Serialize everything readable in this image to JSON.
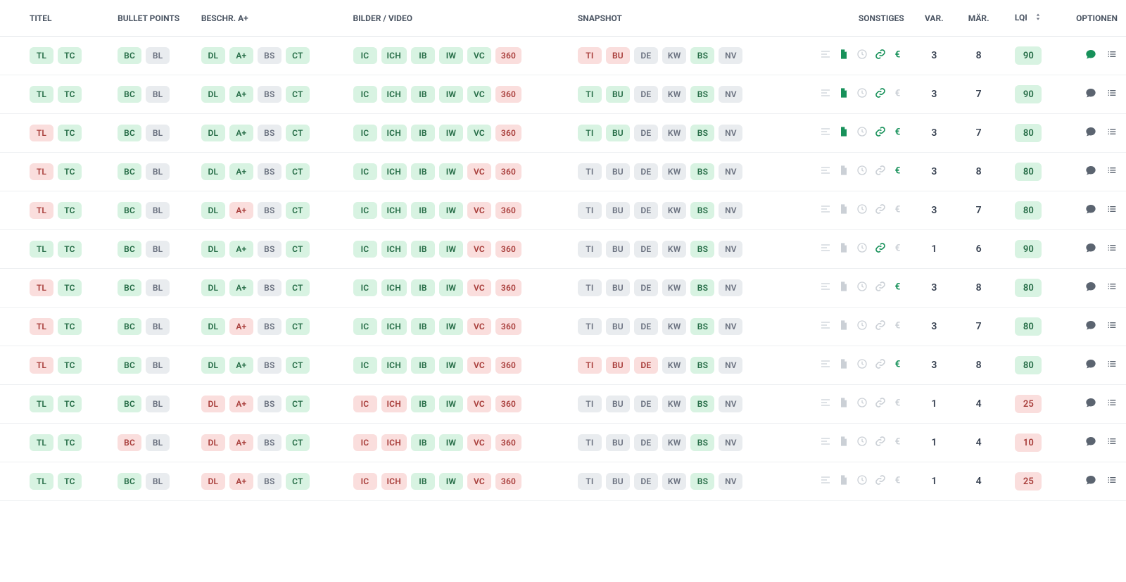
{
  "columns": {
    "titel": "TITEL",
    "bullet": "BULLET POINTS",
    "beschr": "BESCHR. A+",
    "bilder": "BILDER / VIDEO",
    "snapshot": "SNAPSHOT",
    "sonstiges": "SONSTIGES",
    "var": "VAR.",
    "maer": "MÄR.",
    "lqi": "LQI",
    "optionen": "OPTIONEN"
  },
  "rows": [
    {
      "titel": [
        {
          "t": "TL",
          "s": "ok"
        },
        {
          "t": "TC",
          "s": "ok"
        }
      ],
      "bullet": [
        {
          "t": "BC",
          "s": "ok"
        },
        {
          "t": "BL",
          "s": "mut"
        }
      ],
      "beschr": [
        {
          "t": "DL",
          "s": "ok"
        },
        {
          "t": "A+",
          "s": "ok"
        },
        {
          "t": "BS",
          "s": "mut"
        },
        {
          "t": "CT",
          "s": "ok"
        }
      ],
      "bilder": [
        {
          "t": "IC",
          "s": "ok"
        },
        {
          "t": "ICH",
          "s": "ok"
        },
        {
          "t": "IB",
          "s": "ok"
        },
        {
          "t": "IW",
          "s": "ok"
        },
        {
          "t": "VC",
          "s": "ok"
        },
        {
          "t": "360",
          "s": "bad"
        }
      ],
      "snapshot": [
        {
          "t": "TI",
          "s": "bad"
        },
        {
          "t": "BU",
          "s": "bad"
        },
        {
          "t": "DE",
          "s": "mut"
        },
        {
          "t": "KW",
          "s": "mut"
        },
        {
          "t": "BS",
          "s": "ok"
        },
        {
          "t": "NV",
          "s": "mut"
        }
      ],
      "sonst": {
        "align": true,
        "doc": true,
        "clock": false,
        "link": true,
        "euro": true
      },
      "var": 3,
      "maer": 8,
      "lqi": 90,
      "lqi_s": "ok",
      "chat_active": true
    },
    {
      "titel": [
        {
          "t": "TL",
          "s": "ok"
        },
        {
          "t": "TC",
          "s": "ok"
        }
      ],
      "bullet": [
        {
          "t": "BC",
          "s": "ok"
        },
        {
          "t": "BL",
          "s": "mut"
        }
      ],
      "beschr": [
        {
          "t": "DL",
          "s": "ok"
        },
        {
          "t": "A+",
          "s": "ok"
        },
        {
          "t": "BS",
          "s": "mut"
        },
        {
          "t": "CT",
          "s": "ok"
        }
      ],
      "bilder": [
        {
          "t": "IC",
          "s": "ok"
        },
        {
          "t": "ICH",
          "s": "ok"
        },
        {
          "t": "IB",
          "s": "ok"
        },
        {
          "t": "IW",
          "s": "ok"
        },
        {
          "t": "VC",
          "s": "ok"
        },
        {
          "t": "360",
          "s": "bad"
        }
      ],
      "snapshot": [
        {
          "t": "TI",
          "s": "ok"
        },
        {
          "t": "BU",
          "s": "ok"
        },
        {
          "t": "DE",
          "s": "mut"
        },
        {
          "t": "KW",
          "s": "mut"
        },
        {
          "t": "BS",
          "s": "ok"
        },
        {
          "t": "NV",
          "s": "mut"
        }
      ],
      "sonst": {
        "align": true,
        "doc": true,
        "clock": false,
        "link": true,
        "euro": false
      },
      "var": 3,
      "maer": 7,
      "lqi": 90,
      "lqi_s": "ok",
      "chat_active": false
    },
    {
      "titel": [
        {
          "t": "TL",
          "s": "bad"
        },
        {
          "t": "TC",
          "s": "ok"
        }
      ],
      "bullet": [
        {
          "t": "BC",
          "s": "ok"
        },
        {
          "t": "BL",
          "s": "mut"
        }
      ],
      "beschr": [
        {
          "t": "DL",
          "s": "ok"
        },
        {
          "t": "A+",
          "s": "ok"
        },
        {
          "t": "BS",
          "s": "mut"
        },
        {
          "t": "CT",
          "s": "ok"
        }
      ],
      "bilder": [
        {
          "t": "IC",
          "s": "ok"
        },
        {
          "t": "ICH",
          "s": "ok"
        },
        {
          "t": "IB",
          "s": "ok"
        },
        {
          "t": "IW",
          "s": "ok"
        },
        {
          "t": "VC",
          "s": "ok"
        },
        {
          "t": "360",
          "s": "bad"
        }
      ],
      "snapshot": [
        {
          "t": "TI",
          "s": "ok"
        },
        {
          "t": "BU",
          "s": "ok"
        },
        {
          "t": "DE",
          "s": "mut"
        },
        {
          "t": "KW",
          "s": "mut"
        },
        {
          "t": "BS",
          "s": "ok"
        },
        {
          "t": "NV",
          "s": "mut"
        }
      ],
      "sonst": {
        "align": true,
        "doc": true,
        "clock": false,
        "link": true,
        "euro": true
      },
      "var": 3,
      "maer": 7,
      "lqi": 80,
      "lqi_s": "ok",
      "chat_active": false
    },
    {
      "titel": [
        {
          "t": "TL",
          "s": "bad"
        },
        {
          "t": "TC",
          "s": "ok"
        }
      ],
      "bullet": [
        {
          "t": "BC",
          "s": "ok"
        },
        {
          "t": "BL",
          "s": "mut"
        }
      ],
      "beschr": [
        {
          "t": "DL",
          "s": "ok"
        },
        {
          "t": "A+",
          "s": "ok"
        },
        {
          "t": "BS",
          "s": "mut"
        },
        {
          "t": "CT",
          "s": "ok"
        }
      ],
      "bilder": [
        {
          "t": "IC",
          "s": "ok"
        },
        {
          "t": "ICH",
          "s": "ok"
        },
        {
          "t": "IB",
          "s": "ok"
        },
        {
          "t": "IW",
          "s": "ok"
        },
        {
          "t": "VC",
          "s": "bad"
        },
        {
          "t": "360",
          "s": "bad"
        }
      ],
      "snapshot": [
        {
          "t": "TI",
          "s": "mut"
        },
        {
          "t": "BU",
          "s": "mut"
        },
        {
          "t": "DE",
          "s": "mut"
        },
        {
          "t": "KW",
          "s": "mut"
        },
        {
          "t": "BS",
          "s": "ok"
        },
        {
          "t": "NV",
          "s": "mut"
        }
      ],
      "sonst": {
        "align": true,
        "doc": false,
        "clock": false,
        "link": false,
        "euro": true
      },
      "var": 3,
      "maer": 8,
      "lqi": 80,
      "lqi_s": "ok",
      "chat_active": false
    },
    {
      "titel": [
        {
          "t": "TL",
          "s": "bad"
        },
        {
          "t": "TC",
          "s": "ok"
        }
      ],
      "bullet": [
        {
          "t": "BC",
          "s": "ok"
        },
        {
          "t": "BL",
          "s": "mut"
        }
      ],
      "beschr": [
        {
          "t": "DL",
          "s": "ok"
        },
        {
          "t": "A+",
          "s": "bad"
        },
        {
          "t": "BS",
          "s": "mut"
        },
        {
          "t": "CT",
          "s": "ok"
        }
      ],
      "bilder": [
        {
          "t": "IC",
          "s": "ok"
        },
        {
          "t": "ICH",
          "s": "ok"
        },
        {
          "t": "IB",
          "s": "ok"
        },
        {
          "t": "IW",
          "s": "ok"
        },
        {
          "t": "VC",
          "s": "bad"
        },
        {
          "t": "360",
          "s": "bad"
        }
      ],
      "snapshot": [
        {
          "t": "TI",
          "s": "mut"
        },
        {
          "t": "BU",
          "s": "mut"
        },
        {
          "t": "DE",
          "s": "mut"
        },
        {
          "t": "KW",
          "s": "mut"
        },
        {
          "t": "BS",
          "s": "ok"
        },
        {
          "t": "NV",
          "s": "mut"
        }
      ],
      "sonst": {
        "align": true,
        "doc": false,
        "clock": false,
        "link": false,
        "euro": false
      },
      "var": 3,
      "maer": 7,
      "lqi": 80,
      "lqi_s": "ok",
      "chat_active": false
    },
    {
      "titel": [
        {
          "t": "TL",
          "s": "ok"
        },
        {
          "t": "TC",
          "s": "ok"
        }
      ],
      "bullet": [
        {
          "t": "BC",
          "s": "ok"
        },
        {
          "t": "BL",
          "s": "mut"
        }
      ],
      "beschr": [
        {
          "t": "DL",
          "s": "ok"
        },
        {
          "t": "A+",
          "s": "ok"
        },
        {
          "t": "BS",
          "s": "mut"
        },
        {
          "t": "CT",
          "s": "ok"
        }
      ],
      "bilder": [
        {
          "t": "IC",
          "s": "ok"
        },
        {
          "t": "ICH",
          "s": "ok"
        },
        {
          "t": "IB",
          "s": "ok"
        },
        {
          "t": "IW",
          "s": "ok"
        },
        {
          "t": "VC",
          "s": "bad"
        },
        {
          "t": "360",
          "s": "bad"
        }
      ],
      "snapshot": [
        {
          "t": "TI",
          "s": "mut"
        },
        {
          "t": "BU",
          "s": "mut"
        },
        {
          "t": "DE",
          "s": "mut"
        },
        {
          "t": "KW",
          "s": "mut"
        },
        {
          "t": "BS",
          "s": "ok"
        },
        {
          "t": "NV",
          "s": "mut"
        }
      ],
      "sonst": {
        "align": true,
        "doc": false,
        "clock": false,
        "link": true,
        "euro": false
      },
      "var": 1,
      "maer": 6,
      "lqi": 90,
      "lqi_s": "ok",
      "chat_active": false
    },
    {
      "titel": [
        {
          "t": "TL",
          "s": "bad"
        },
        {
          "t": "TC",
          "s": "ok"
        }
      ],
      "bullet": [
        {
          "t": "BC",
          "s": "ok"
        },
        {
          "t": "BL",
          "s": "mut"
        }
      ],
      "beschr": [
        {
          "t": "DL",
          "s": "ok"
        },
        {
          "t": "A+",
          "s": "ok"
        },
        {
          "t": "BS",
          "s": "mut"
        },
        {
          "t": "CT",
          "s": "ok"
        }
      ],
      "bilder": [
        {
          "t": "IC",
          "s": "ok"
        },
        {
          "t": "ICH",
          "s": "ok"
        },
        {
          "t": "IB",
          "s": "ok"
        },
        {
          "t": "IW",
          "s": "ok"
        },
        {
          "t": "VC",
          "s": "bad"
        },
        {
          "t": "360",
          "s": "bad"
        }
      ],
      "snapshot": [
        {
          "t": "TI",
          "s": "mut"
        },
        {
          "t": "BU",
          "s": "mut"
        },
        {
          "t": "DE",
          "s": "mut"
        },
        {
          "t": "KW",
          "s": "mut"
        },
        {
          "t": "BS",
          "s": "ok"
        },
        {
          "t": "NV",
          "s": "mut"
        }
      ],
      "sonst": {
        "align": true,
        "doc": false,
        "clock": false,
        "link": false,
        "euro": true
      },
      "var": 3,
      "maer": 8,
      "lqi": 80,
      "lqi_s": "ok",
      "chat_active": false
    },
    {
      "titel": [
        {
          "t": "TL",
          "s": "bad"
        },
        {
          "t": "TC",
          "s": "ok"
        }
      ],
      "bullet": [
        {
          "t": "BC",
          "s": "ok"
        },
        {
          "t": "BL",
          "s": "mut"
        }
      ],
      "beschr": [
        {
          "t": "DL",
          "s": "ok"
        },
        {
          "t": "A+",
          "s": "bad"
        },
        {
          "t": "BS",
          "s": "mut"
        },
        {
          "t": "CT",
          "s": "ok"
        }
      ],
      "bilder": [
        {
          "t": "IC",
          "s": "ok"
        },
        {
          "t": "ICH",
          "s": "ok"
        },
        {
          "t": "IB",
          "s": "ok"
        },
        {
          "t": "IW",
          "s": "ok"
        },
        {
          "t": "VC",
          "s": "bad"
        },
        {
          "t": "360",
          "s": "bad"
        }
      ],
      "snapshot": [
        {
          "t": "TI",
          "s": "mut"
        },
        {
          "t": "BU",
          "s": "mut"
        },
        {
          "t": "DE",
          "s": "mut"
        },
        {
          "t": "KW",
          "s": "mut"
        },
        {
          "t": "BS",
          "s": "ok"
        },
        {
          "t": "NV",
          "s": "mut"
        }
      ],
      "sonst": {
        "align": true,
        "doc": false,
        "clock": false,
        "link": false,
        "euro": false
      },
      "var": 3,
      "maer": 7,
      "lqi": 80,
      "lqi_s": "ok",
      "chat_active": false
    },
    {
      "titel": [
        {
          "t": "TL",
          "s": "bad"
        },
        {
          "t": "TC",
          "s": "ok"
        }
      ],
      "bullet": [
        {
          "t": "BC",
          "s": "ok"
        },
        {
          "t": "BL",
          "s": "mut"
        }
      ],
      "beschr": [
        {
          "t": "DL",
          "s": "ok"
        },
        {
          "t": "A+",
          "s": "ok"
        },
        {
          "t": "BS",
          "s": "mut"
        },
        {
          "t": "CT",
          "s": "ok"
        }
      ],
      "bilder": [
        {
          "t": "IC",
          "s": "ok"
        },
        {
          "t": "ICH",
          "s": "ok"
        },
        {
          "t": "IB",
          "s": "ok"
        },
        {
          "t": "IW",
          "s": "ok"
        },
        {
          "t": "VC",
          "s": "bad"
        },
        {
          "t": "360",
          "s": "bad"
        }
      ],
      "snapshot": [
        {
          "t": "TI",
          "s": "bad"
        },
        {
          "t": "BU",
          "s": "bad"
        },
        {
          "t": "DE",
          "s": "bad"
        },
        {
          "t": "KW",
          "s": "mut"
        },
        {
          "t": "BS",
          "s": "ok"
        },
        {
          "t": "NV",
          "s": "mut"
        }
      ],
      "sonst": {
        "align": true,
        "doc": false,
        "clock": false,
        "link": false,
        "euro": true
      },
      "var": 3,
      "maer": 8,
      "lqi": 80,
      "lqi_s": "ok",
      "chat_active": false
    },
    {
      "titel": [
        {
          "t": "TL",
          "s": "ok"
        },
        {
          "t": "TC",
          "s": "ok"
        }
      ],
      "bullet": [
        {
          "t": "BC",
          "s": "ok"
        },
        {
          "t": "BL",
          "s": "mut"
        }
      ],
      "beschr": [
        {
          "t": "DL",
          "s": "bad"
        },
        {
          "t": "A+",
          "s": "bad"
        },
        {
          "t": "BS",
          "s": "mut"
        },
        {
          "t": "CT",
          "s": "ok"
        }
      ],
      "bilder": [
        {
          "t": "IC",
          "s": "bad"
        },
        {
          "t": "ICH",
          "s": "bad"
        },
        {
          "t": "IB",
          "s": "ok"
        },
        {
          "t": "IW",
          "s": "ok"
        },
        {
          "t": "VC",
          "s": "bad"
        },
        {
          "t": "360",
          "s": "bad"
        }
      ],
      "snapshot": [
        {
          "t": "TI",
          "s": "mut"
        },
        {
          "t": "BU",
          "s": "mut"
        },
        {
          "t": "DE",
          "s": "mut"
        },
        {
          "t": "KW",
          "s": "mut"
        },
        {
          "t": "BS",
          "s": "ok"
        },
        {
          "t": "NV",
          "s": "mut"
        }
      ],
      "sonst": {
        "align": true,
        "doc": false,
        "clock": false,
        "link": false,
        "euro": false
      },
      "var": 1,
      "maer": 4,
      "lqi": 25,
      "lqi_s": "bad",
      "chat_active": false
    },
    {
      "titel": [
        {
          "t": "TL",
          "s": "ok"
        },
        {
          "t": "TC",
          "s": "ok"
        }
      ],
      "bullet": [
        {
          "t": "BC",
          "s": "bad"
        },
        {
          "t": "BL",
          "s": "mut"
        }
      ],
      "beschr": [
        {
          "t": "DL",
          "s": "bad"
        },
        {
          "t": "A+",
          "s": "bad"
        },
        {
          "t": "BS",
          "s": "mut"
        },
        {
          "t": "CT",
          "s": "ok"
        }
      ],
      "bilder": [
        {
          "t": "IC",
          "s": "bad"
        },
        {
          "t": "ICH",
          "s": "bad"
        },
        {
          "t": "IB",
          "s": "ok"
        },
        {
          "t": "IW",
          "s": "ok"
        },
        {
          "t": "VC",
          "s": "bad"
        },
        {
          "t": "360",
          "s": "bad"
        }
      ],
      "snapshot": [
        {
          "t": "TI",
          "s": "mut"
        },
        {
          "t": "BU",
          "s": "mut"
        },
        {
          "t": "DE",
          "s": "mut"
        },
        {
          "t": "KW",
          "s": "mut"
        },
        {
          "t": "BS",
          "s": "ok"
        },
        {
          "t": "NV",
          "s": "mut"
        }
      ],
      "sonst": {
        "align": true,
        "doc": false,
        "clock": false,
        "link": false,
        "euro": false
      },
      "var": 1,
      "maer": 4,
      "lqi": 10,
      "lqi_s": "bad",
      "chat_active": false
    },
    {
      "titel": [
        {
          "t": "TL",
          "s": "ok"
        },
        {
          "t": "TC",
          "s": "ok"
        }
      ],
      "bullet": [
        {
          "t": "BC",
          "s": "ok"
        },
        {
          "t": "BL",
          "s": "mut"
        }
      ],
      "beschr": [
        {
          "t": "DL",
          "s": "bad"
        },
        {
          "t": "A+",
          "s": "bad"
        },
        {
          "t": "BS",
          "s": "mut"
        },
        {
          "t": "CT",
          "s": "ok"
        }
      ],
      "bilder": [
        {
          "t": "IC",
          "s": "bad"
        },
        {
          "t": "ICH",
          "s": "bad"
        },
        {
          "t": "IB",
          "s": "ok"
        },
        {
          "t": "IW",
          "s": "ok"
        },
        {
          "t": "VC",
          "s": "bad"
        },
        {
          "t": "360",
          "s": "bad"
        }
      ],
      "snapshot": [
        {
          "t": "TI",
          "s": "mut"
        },
        {
          "t": "BU",
          "s": "mut"
        },
        {
          "t": "DE",
          "s": "mut"
        },
        {
          "t": "KW",
          "s": "mut"
        },
        {
          "t": "BS",
          "s": "ok"
        },
        {
          "t": "NV",
          "s": "mut"
        }
      ],
      "sonst": {
        "align": true,
        "doc": false,
        "clock": false,
        "link": false,
        "euro": false
      },
      "var": 1,
      "maer": 4,
      "lqi": 25,
      "lqi_s": "bad",
      "chat_active": false
    }
  ]
}
